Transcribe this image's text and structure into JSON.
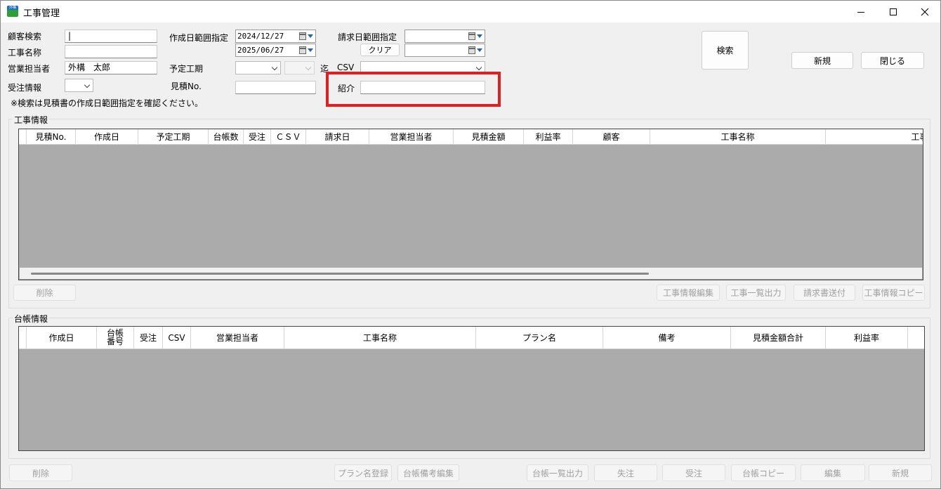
{
  "window": {
    "title": "工事管理",
    "app_icon_text": "外構"
  },
  "form": {
    "customer_search_label": "顧客検索",
    "customer_search_value": "|",
    "project_name_label": "工事名称",
    "project_name_value": "",
    "sales_rep_label": "営業担当者",
    "sales_rep_value": "外構　太郎",
    "order_info_label": "受注情報",
    "created_range_label": "作成日範囲指定",
    "created_from": "2024/12/27",
    "created_to": "2025/06/27",
    "schedule_label": "予定工期",
    "schedule_to_mark": "迄",
    "estimate_no_label": "見積No.",
    "billing_range_label": "請求日範囲指定",
    "clear_button": "クリア",
    "csv_label": "CSV",
    "referral_label": "紹介",
    "note": "※検索は見積書の作成日範囲指定を確認ください。"
  },
  "buttons": {
    "search": "検索",
    "new": "新規",
    "close": "閉じる"
  },
  "project_section": {
    "title": "工事情報",
    "columns": [
      "見積No.",
      "作成日",
      "予定工期",
      "台帳数",
      "受注",
      "ＣＳＶ",
      "請求日",
      "営業担当者",
      "見積金額",
      "利益率",
      "顧客",
      "工事名称",
      "工事場"
    ],
    "rows": [],
    "delete_button": "削除",
    "edit_button": "工事情報編集",
    "list_output_button": "工事一覧出力",
    "invoice_send_button": "請求書送付",
    "copy_button": "工事情報コピー"
  },
  "ledger_section": {
    "title": "台帳情報",
    "columns": [
      "作成日",
      "台帳\n番号",
      "受注",
      "CSV",
      "営業担当者",
      "工事名称",
      "プラン名",
      "備考",
      "見積金額合計",
      "利益率"
    ],
    "rows": []
  },
  "bottom_buttons": {
    "delete": "削除",
    "plan_register": "プラン名登録",
    "ledger_note_edit": "台帳備考編集",
    "ledger_list_output": "台帳一覧出力",
    "lost_order": "失注",
    "order": "受注",
    "ledger_copy": "台帳コピー",
    "edit": "編集",
    "new": "新規"
  }
}
